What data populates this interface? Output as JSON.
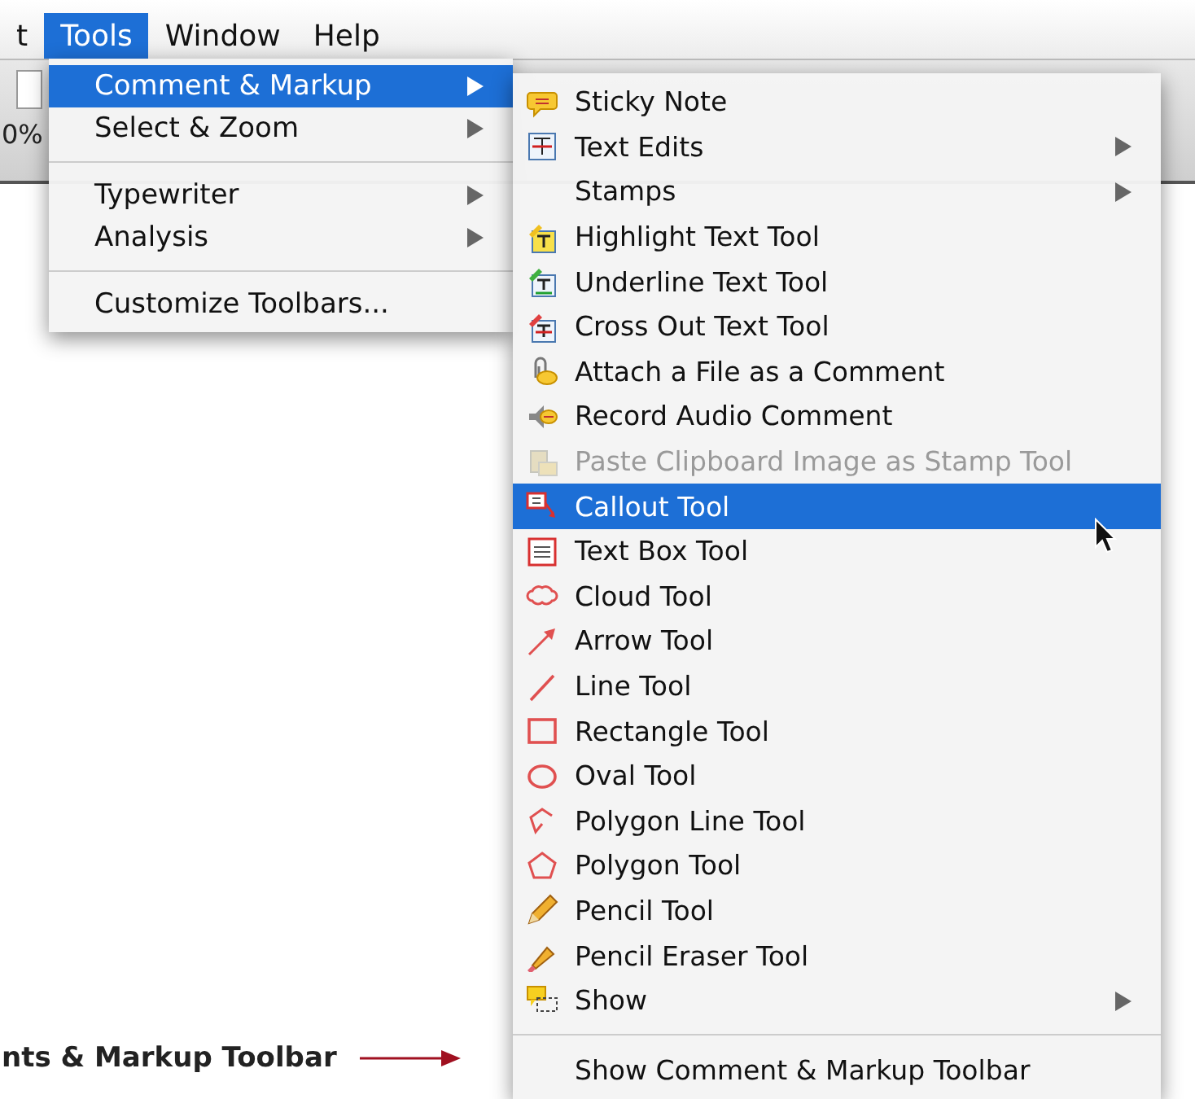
{
  "menu_bar": {
    "items": [
      {
        "label": "t",
        "selected": false
      },
      {
        "label": "Tools",
        "selected": true
      },
      {
        "label": "Window",
        "selected": false
      },
      {
        "label": "Help",
        "selected": false
      }
    ]
  },
  "toolbar": {
    "zoom": "0%"
  },
  "tools_menu": {
    "items": [
      {
        "kind": "item",
        "label": "Comment & Markup",
        "has_submenu": true,
        "selected": true
      },
      {
        "kind": "item",
        "label": "Select & Zoom",
        "has_submenu": true,
        "selected": false
      },
      {
        "kind": "separator"
      },
      {
        "kind": "item",
        "label": "Typewriter",
        "has_submenu": true,
        "selected": false
      },
      {
        "kind": "item",
        "label": "Analysis",
        "has_submenu": true,
        "selected": false
      },
      {
        "kind": "separator"
      },
      {
        "kind": "item",
        "label": "Customize Toolbars...",
        "has_submenu": false,
        "selected": false
      }
    ]
  },
  "submenu": {
    "items": [
      {
        "kind": "item",
        "label": "Sticky Note",
        "has_submenu": false,
        "disabled": false,
        "selected": false
      },
      {
        "kind": "item",
        "label": "Text Edits",
        "has_submenu": true,
        "disabled": false,
        "selected": false
      },
      {
        "kind": "item",
        "label": "Stamps",
        "has_submenu": true,
        "disabled": false,
        "selected": false
      },
      {
        "kind": "item",
        "label": "Highlight Text Tool",
        "has_submenu": false,
        "disabled": false,
        "selected": false
      },
      {
        "kind": "item",
        "label": "Underline Text Tool",
        "has_submenu": false,
        "disabled": false,
        "selected": false
      },
      {
        "kind": "item",
        "label": "Cross Out Text Tool",
        "has_submenu": false,
        "disabled": false,
        "selected": false
      },
      {
        "kind": "item",
        "label": "Attach a File as a Comment",
        "has_submenu": false,
        "disabled": false,
        "selected": false
      },
      {
        "kind": "item",
        "label": "Record Audio Comment",
        "has_submenu": false,
        "disabled": false,
        "selected": false
      },
      {
        "kind": "item",
        "label": "Paste Clipboard Image as Stamp Tool",
        "has_submenu": false,
        "disabled": true,
        "selected": false
      },
      {
        "kind": "item",
        "label": "Callout Tool",
        "has_submenu": false,
        "disabled": false,
        "selected": true
      },
      {
        "kind": "item",
        "label": "Text Box Tool",
        "has_submenu": false,
        "disabled": false,
        "selected": false
      },
      {
        "kind": "item",
        "label": "Cloud Tool",
        "has_submenu": false,
        "disabled": false,
        "selected": false
      },
      {
        "kind": "item",
        "label": "Arrow Tool",
        "has_submenu": false,
        "disabled": false,
        "selected": false
      },
      {
        "kind": "item",
        "label": "Line Tool",
        "has_submenu": false,
        "disabled": false,
        "selected": false
      },
      {
        "kind": "item",
        "label": "Rectangle Tool",
        "has_submenu": false,
        "disabled": false,
        "selected": false
      },
      {
        "kind": "item",
        "label": "Oval Tool",
        "has_submenu": false,
        "disabled": false,
        "selected": false
      },
      {
        "kind": "item",
        "label": "Polygon Line Tool",
        "has_submenu": false,
        "disabled": false,
        "selected": false
      },
      {
        "kind": "item",
        "label": "Polygon Tool",
        "has_submenu": false,
        "disabled": false,
        "selected": false
      },
      {
        "kind": "item",
        "label": "Pencil Tool",
        "has_submenu": false,
        "disabled": false,
        "selected": false
      },
      {
        "kind": "item",
        "label": "Pencil Eraser Tool",
        "has_submenu": false,
        "disabled": false,
        "selected": false
      },
      {
        "kind": "item",
        "label": "Show",
        "has_submenu": true,
        "disabled": false,
        "selected": false
      },
      {
        "kind": "separator"
      },
      {
        "kind": "item",
        "label": "Show Comment & Markup Toolbar",
        "has_submenu": false,
        "disabled": false,
        "selected": false
      }
    ]
  },
  "annotation": {
    "text": "nts & Markup Toolbar"
  }
}
